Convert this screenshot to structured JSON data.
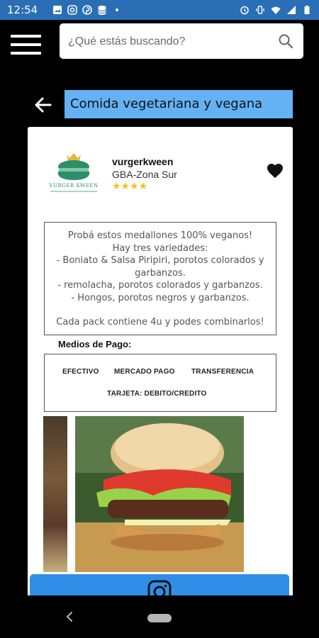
{
  "status_bar": {
    "time": "12:54",
    "icons_left": [
      "image-icon",
      "instagram-icon",
      "pinterest-icon",
      "storage-icon",
      "dot-icon"
    ],
    "icons_right": [
      "alarm-icon",
      "vibrate-icon",
      "wifi-icon",
      "signal-icon",
      "battery-icon"
    ]
  },
  "search": {
    "placeholder": "¿Qué estás buscando?"
  },
  "category": {
    "title": "Comida vegetariana y vegana"
  },
  "seller": {
    "name": "vurgerkween",
    "zone": "GBA-Zona Sur",
    "rating": "★★★★",
    "logo_text": "VURGER KWEEN"
  },
  "description": {
    "lines": [
      "Probá estos medallones 100% veganos!",
      "Hay tres variedades:",
      "- Boniato & Salsa Piripiri, porotos colorados y garbanzos.",
      "- remolacha, porotos colorados y garbanzos.",
      "- Hongos, porotos negros y garbanzos.",
      "Cada pack contiene 4u y podes combinarlos!"
    ]
  },
  "payment": {
    "title": "Medios de Pago:",
    "methods": [
      "EFECTIVO",
      "MERCADO PAGO",
      "TRANSFERENCIA",
      "TARJETA: DEBITO/CREDITO"
    ]
  },
  "colors": {
    "status_bar": "#2a6fb5",
    "category_bg": "#64b2f4",
    "instagram_button": "#2f8fe8",
    "star": "#f3c21b"
  }
}
